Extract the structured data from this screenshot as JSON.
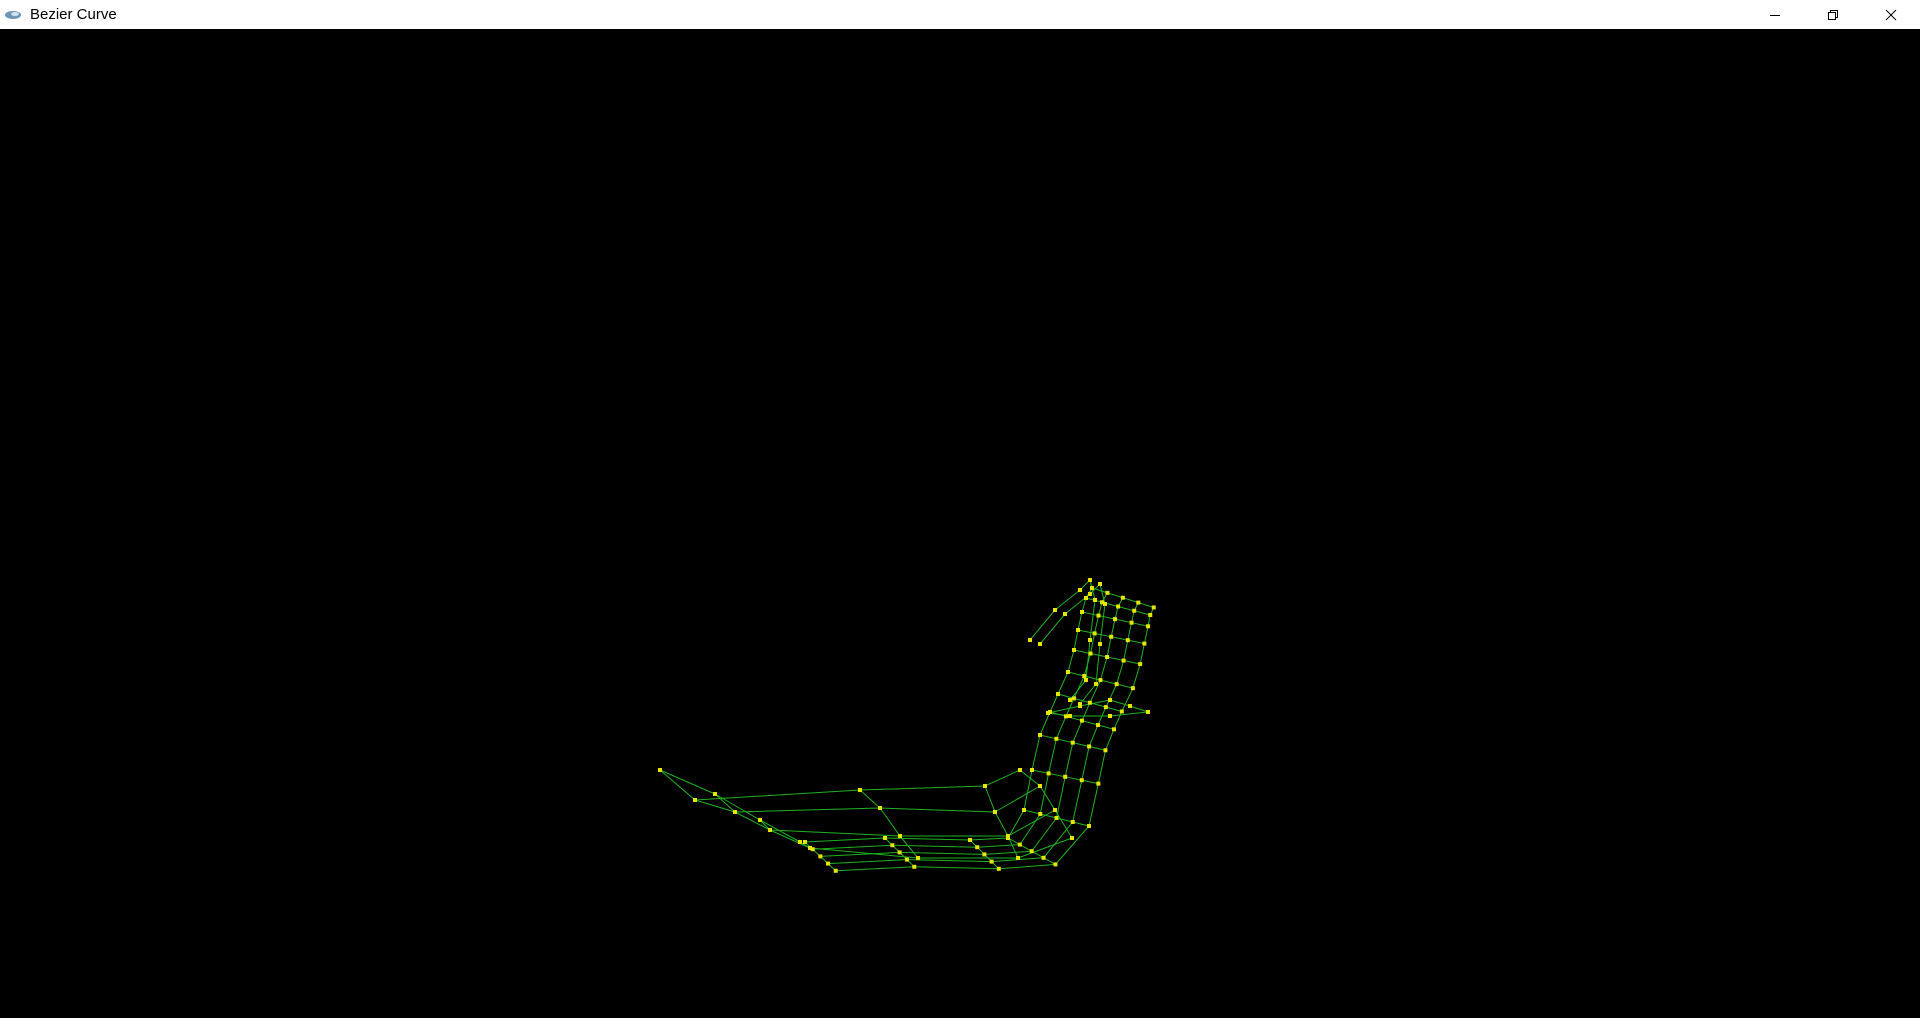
{
  "window": {
    "title": "Bezier Curve",
    "icons": {
      "app": "app-logo-icon",
      "minimize": "minimize-icon",
      "restore": "restore-icon",
      "close": "close-icon"
    }
  },
  "viewport": {
    "background_color": "#000000",
    "wire_color": "#1db31d",
    "point_color": "#e6e600"
  }
}
